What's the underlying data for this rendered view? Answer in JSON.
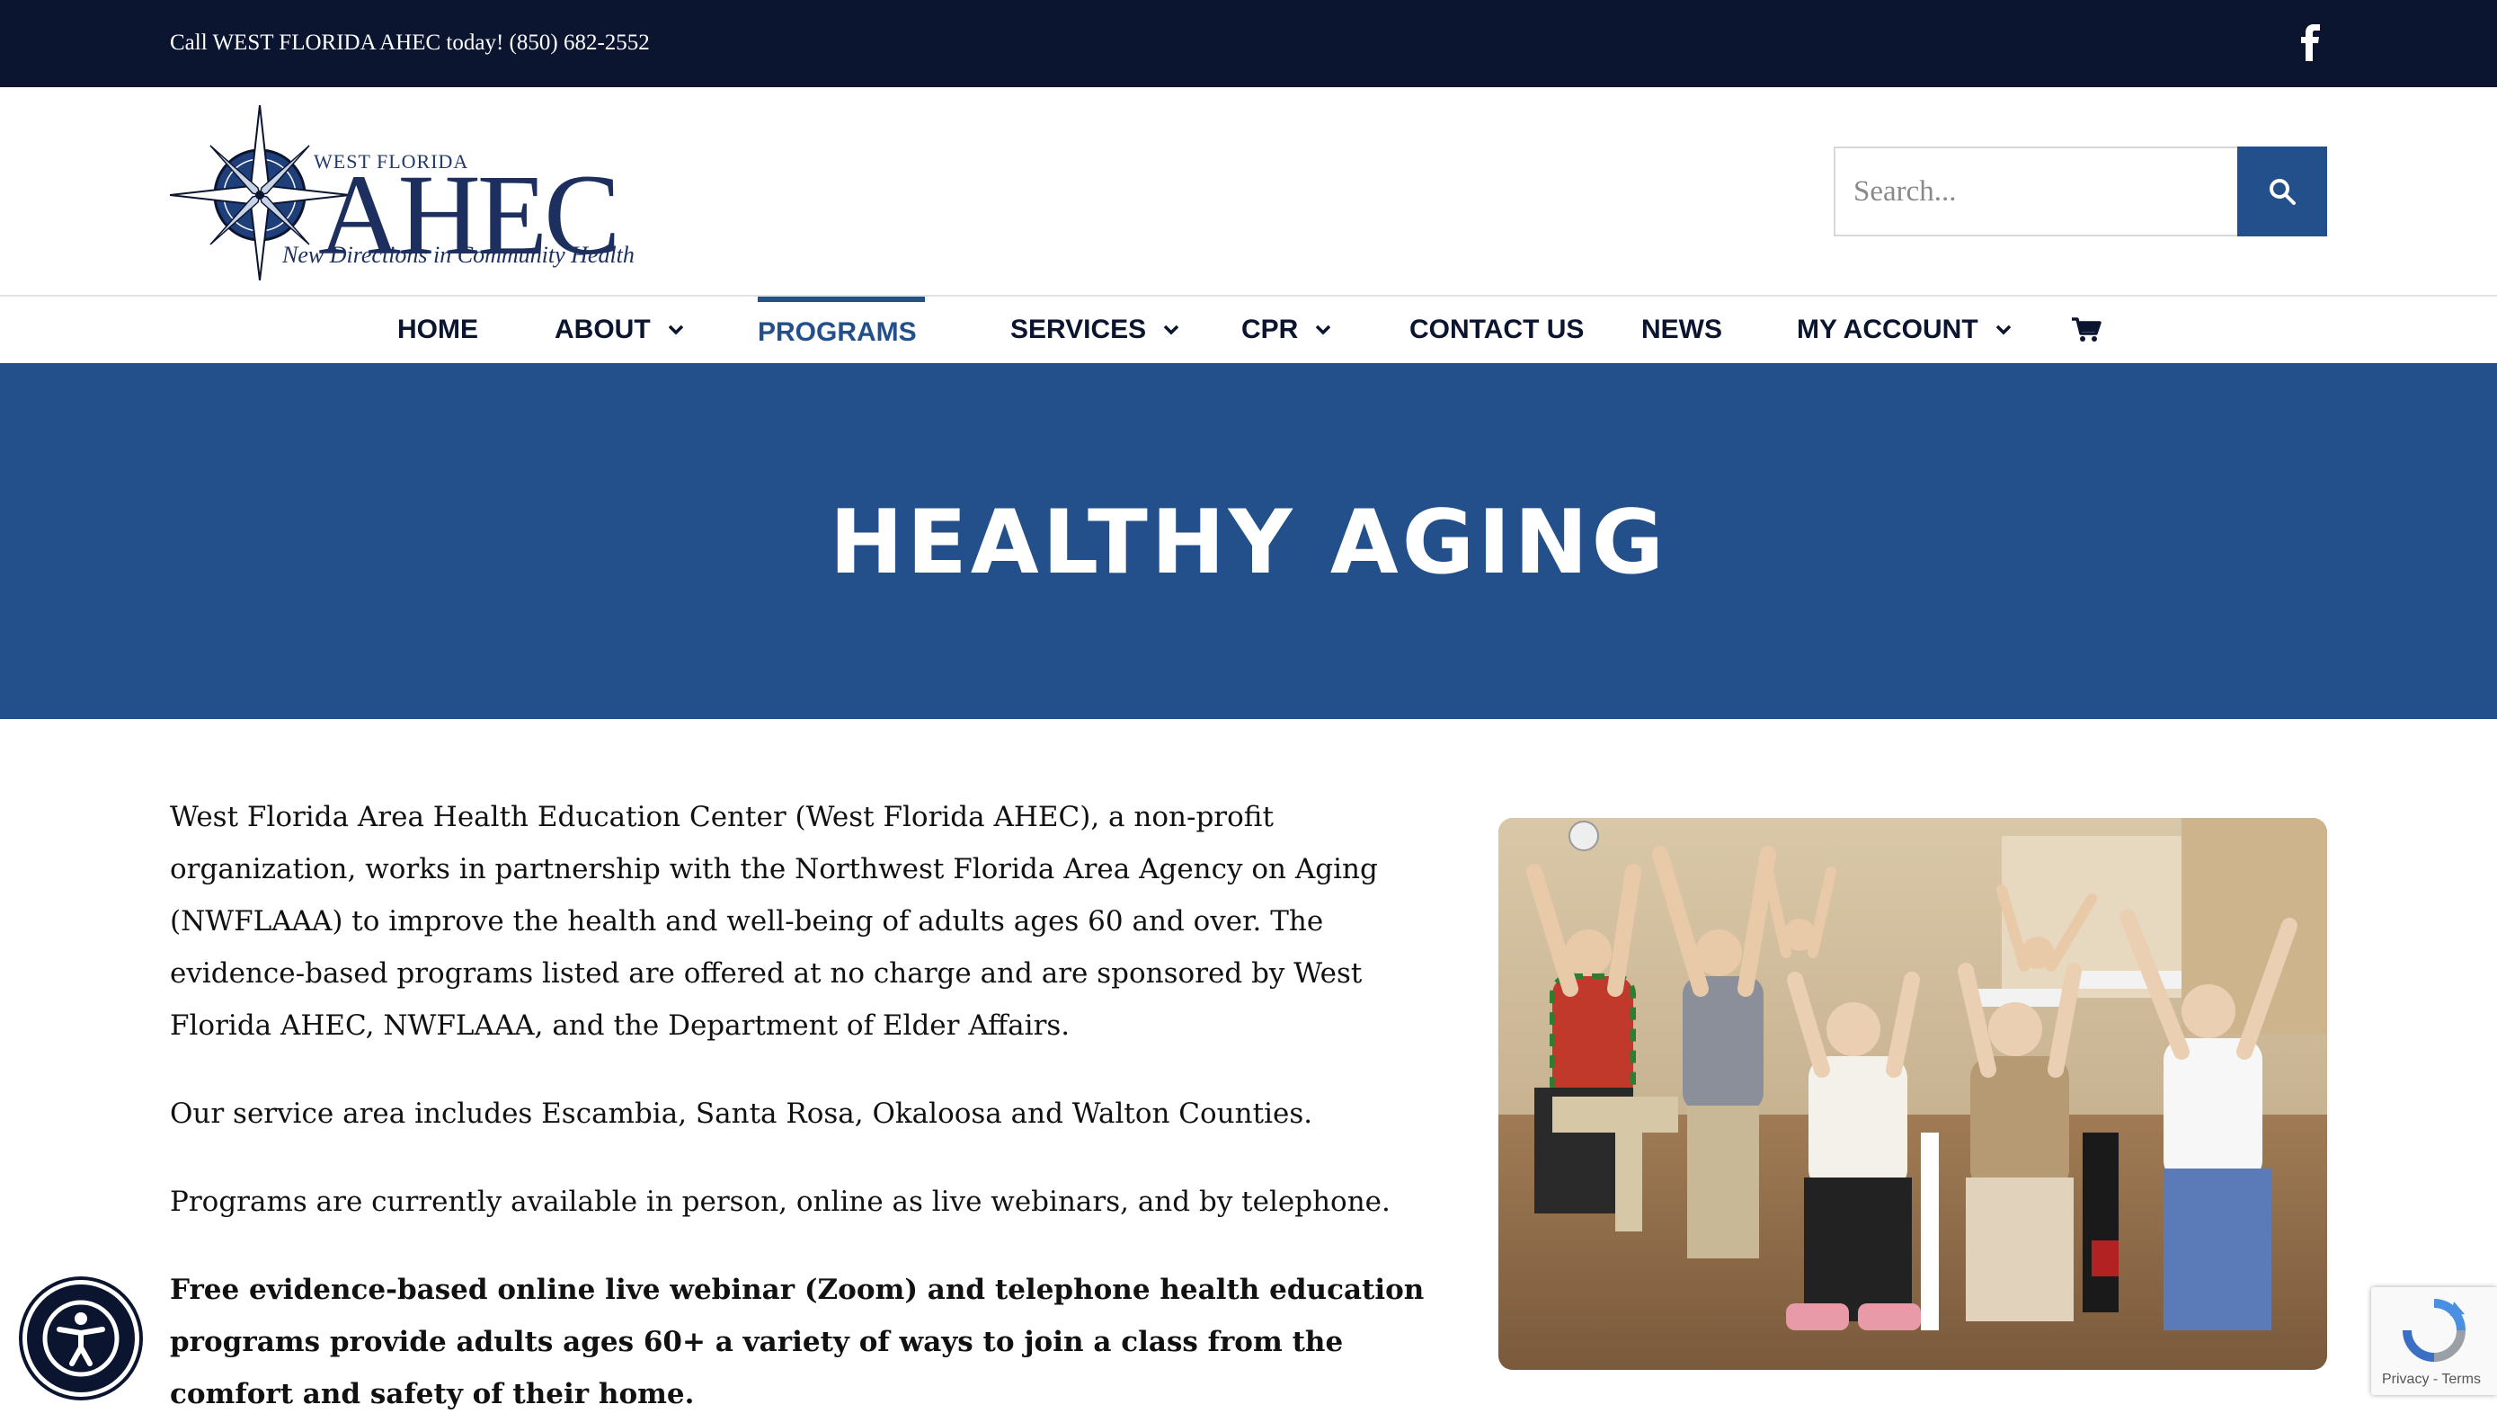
{
  "topbar": {
    "call_text": "Call WEST FLORIDA AHEC today! (850) 682-2552",
    "social_icon": "facebook-icon"
  },
  "logo": {
    "line1": "WEST FLORIDA",
    "line2": "AHEC",
    "tagline": "New Directions in Community Health"
  },
  "search": {
    "placeholder": "Search...",
    "icon": "search-icon"
  },
  "nav": {
    "items": [
      {
        "label": "HOME",
        "has_dropdown": false
      },
      {
        "label": "ABOUT",
        "has_dropdown": true
      },
      {
        "label": "PROGRAMS",
        "has_dropdown": true,
        "active": true
      },
      {
        "label": "SERVICES",
        "has_dropdown": true
      },
      {
        "label": "CPR",
        "has_dropdown": true
      },
      {
        "label": "CONTACT US",
        "has_dropdown": false
      },
      {
        "label": "NEWS",
        "has_dropdown": false
      },
      {
        "label": "MY ACCOUNT",
        "has_dropdown": true
      }
    ],
    "cart_icon": "shopping-cart-icon"
  },
  "hero": {
    "title": "HEALTHY AGING"
  },
  "content": {
    "p1": "West Florida Area Health Education Center (West Florida AHEC), a non-profit organization, works in partnership with the Northwest Florida Area Agency on Aging (NWFLAAA) to improve the health and well-being of adults ages 60 and over. The evidence-based programs listed are offered at no charge and are sponsored by West Florida AHEC, NWFLAAA, and the Department of Elder Affairs.",
    "p2": "Our service area includes Escambia, Santa Rosa, Okaloosa and Walton Counties.",
    "p3": "Programs are currently available in person, online as live webinars, and by telephone.",
    "p4": "Free evidence-based online live webinar (Zoom) and telephone health education programs provide adults ages 60+ a variety of ways to join a class from the comfort and safety of their home."
  },
  "recaptcha": {
    "text": "Privacy - Terms"
  },
  "colors": {
    "topbar": "#0b1530",
    "accent": "#23508a",
    "text": "#111111"
  }
}
